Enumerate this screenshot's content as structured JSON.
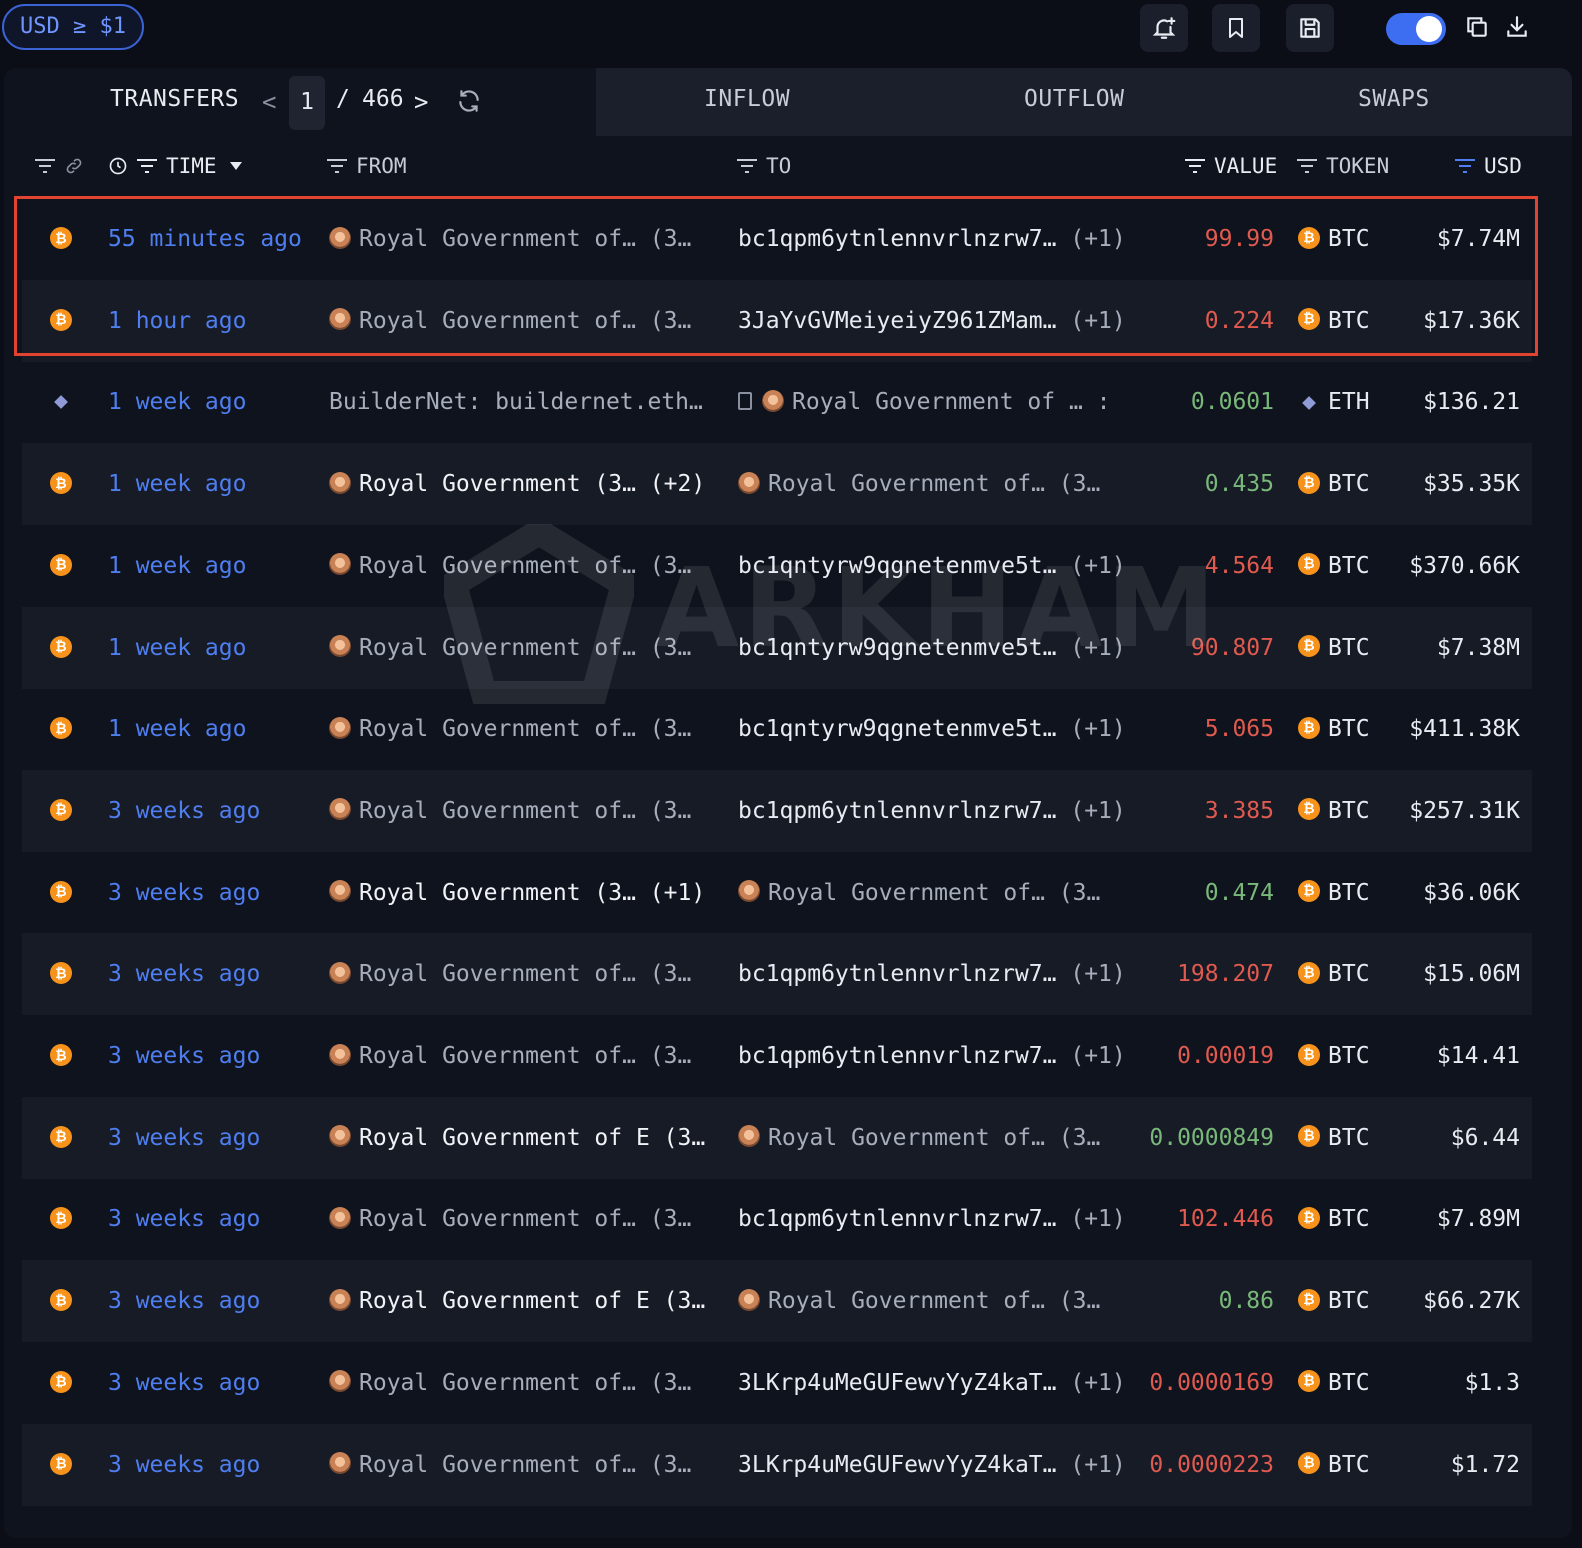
{
  "topbar": {
    "usd_filter": "USD ≥ $1",
    "icons": [
      "bell-plus-icon",
      "bookmark-icon",
      "save-icon",
      "toggle",
      "copy-icon",
      "download-icon"
    ]
  },
  "tabs": {
    "transfers": "TRANSFERS",
    "page": "1",
    "separator": "/",
    "total_pages": "466",
    "inflow": "INFLOW",
    "outflow": "OUTFLOW",
    "swaps": "SWAPS"
  },
  "columns": {
    "time": "TIME",
    "from": "FROM",
    "to": "TO",
    "value": "VALUE",
    "token": "TOKEN",
    "usd": "USD"
  },
  "watermark": "ARKHAM",
  "colors": {
    "accent": "#3d6ef2",
    "time_link": "#4f7ef0",
    "value_out": "#e05a4f",
    "value_in": "#7ab87a",
    "highlight": "#e2442f",
    "btc": "#f7931a"
  },
  "rows": [
    {
      "chain": "btc",
      "time": "55 minutes ago",
      "from": "Royal Government of…",
      "from_suffix": "(3…",
      "to": "bc1qpm6ytnlennvrlnzrw7…",
      "to_suffix": "(+1)",
      "value": "99.99",
      "value_color": "red",
      "token": "BTC",
      "usd": "$7.74M"
    },
    {
      "chain": "btc",
      "time": "1 hour ago",
      "from": "Royal Government of…",
      "from_suffix": "(3…",
      "to": "3JaYvGVMeiyeiyZ961ZMam…",
      "to_suffix": "(+1)",
      "value": "0.224",
      "value_color": "red",
      "token": "BTC",
      "usd": "$17.36K"
    },
    {
      "chain": "eth",
      "time": "1 week ago",
      "from": "BuilderNet: buildernet.eth…",
      "from_suffix": "",
      "to": "Royal Government of …",
      "to_suffix": ":",
      "value": "0.0601",
      "value_color": "green",
      "token": "ETH",
      "usd": "$136.21"
    },
    {
      "chain": "btc",
      "time": "1 week ago",
      "from": "Royal Government",
      "from_suffix": "(3… (+2)",
      "to": "Royal Government of…",
      "to_suffix": "(3…",
      "value": "0.435",
      "value_color": "green",
      "token": "BTC",
      "usd": "$35.35K"
    },
    {
      "chain": "btc",
      "time": "1 week ago",
      "from": "Royal Government of…",
      "from_suffix": "(3…",
      "to": "bc1qntyrw9qgnetenmve5t…",
      "to_suffix": "(+1)",
      "value": "4.564",
      "value_color": "red",
      "token": "BTC",
      "usd": "$370.66K"
    },
    {
      "chain": "btc",
      "time": "1 week ago",
      "from": "Royal Government of…",
      "from_suffix": "(3…",
      "to": "bc1qntyrw9qgnetenmve5t…",
      "to_suffix": "(+1)",
      "value": "90.807",
      "value_color": "red",
      "token": "BTC",
      "usd": "$7.38M"
    },
    {
      "chain": "btc",
      "time": "1 week ago",
      "from": "Royal Government of…",
      "from_suffix": "(3…",
      "to": "bc1qntyrw9qgnetenmve5t…",
      "to_suffix": "(+1)",
      "value": "5.065",
      "value_color": "red",
      "token": "BTC",
      "usd": "$411.38K"
    },
    {
      "chain": "btc",
      "time": "3 weeks ago",
      "from": "Royal Government of…",
      "from_suffix": "(3…",
      "to": "bc1qpm6ytnlennvrlnzrw7…",
      "to_suffix": "(+1)",
      "value": "3.385",
      "value_color": "red",
      "token": "BTC",
      "usd": "$257.31K"
    },
    {
      "chain": "btc",
      "time": "3 weeks ago",
      "from": "Royal Government",
      "from_suffix": "(3… (+1)",
      "to": "Royal Government of…",
      "to_suffix": "(3…",
      "value": "0.474",
      "value_color": "green",
      "token": "BTC",
      "usd": "$36.06K"
    },
    {
      "chain": "btc",
      "time": "3 weeks ago",
      "from": "Royal Government of…",
      "from_suffix": "(3…",
      "to": "bc1qpm6ytnlennvrlnzrw7…",
      "to_suffix": "(+1)",
      "value": "198.207",
      "value_color": "red",
      "token": "BTC",
      "usd": "$15.06M"
    },
    {
      "chain": "btc",
      "time": "3 weeks ago",
      "from": "Royal Government of…",
      "from_suffix": "(3…",
      "to": "bc1qpm6ytnlennvrlnzrw7…",
      "to_suffix": "(+1)",
      "value": "0.00019",
      "value_color": "red",
      "token": "BTC",
      "usd": "$14.41"
    },
    {
      "chain": "btc",
      "time": "3 weeks ago",
      "from": "Royal Government of E",
      "from_suffix": "(3…",
      "to": "Royal Government of…",
      "to_suffix": "(3…",
      "value": "0.0000849",
      "value_color": "green",
      "token": "BTC",
      "usd": "$6.44"
    },
    {
      "chain": "btc",
      "time": "3 weeks ago",
      "from": "Royal Government of…",
      "from_suffix": "(3…",
      "to": "bc1qpm6ytnlennvrlnzrw7…",
      "to_suffix": "(+1)",
      "value": "102.446",
      "value_color": "red",
      "token": "BTC",
      "usd": "$7.89M"
    },
    {
      "chain": "btc",
      "time": "3 weeks ago",
      "from": "Royal Government of E",
      "from_suffix": "(3…",
      "to": "Royal Government of…",
      "to_suffix": "(3…",
      "value": "0.86",
      "value_color": "green",
      "token": "BTC",
      "usd": "$66.27K"
    },
    {
      "chain": "btc",
      "time": "3 weeks ago",
      "from": "Royal Government of…",
      "from_suffix": "(3…",
      "to": "3LKrp4uMeGUFewvYyZ4kaT…",
      "to_suffix": "(+1)",
      "value": "0.0000169",
      "value_color": "red",
      "token": "BTC",
      "usd": "$1.3"
    },
    {
      "chain": "btc",
      "time": "3 weeks ago",
      "from": "Royal Government of…",
      "from_suffix": "(3…",
      "to": "3LKrp4uMeGUFewvYyZ4kaT…",
      "to_suffix": "(+1)",
      "value": "0.0000223",
      "value_color": "red",
      "token": "BTC",
      "usd": "$1.72"
    }
  ]
}
